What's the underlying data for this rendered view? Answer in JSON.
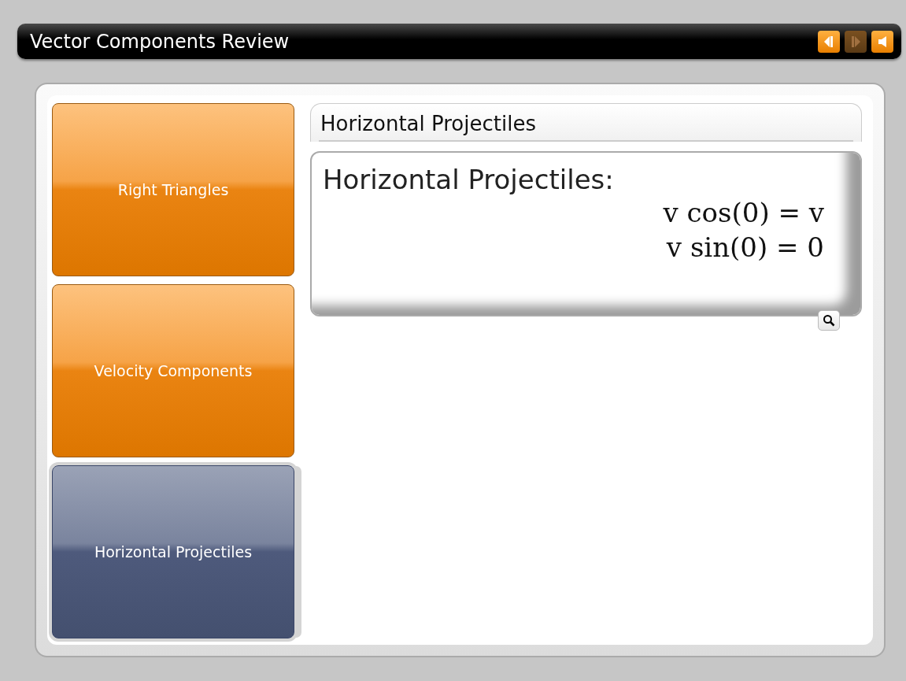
{
  "window": {
    "title": "Vector Components Review"
  },
  "toolbar": [
    {
      "kind": "prev",
      "disabled": false
    },
    {
      "kind": "next",
      "disabled": true
    },
    {
      "kind": "audio",
      "disabled": false
    }
  ],
  "sidebar": {
    "items": [
      {
        "label": "Right Triangles",
        "selected": false
      },
      {
        "label": "Velocity Components",
        "selected": false
      },
      {
        "label": "Horizontal Projectiles",
        "selected": true
      }
    ]
  },
  "content": {
    "heading": "Horizontal Projectiles",
    "card": {
      "title": "Horizontal Projectiles:",
      "equations": [
        "v cos(0) = v",
        "v sin(0) = 0"
      ]
    }
  }
}
